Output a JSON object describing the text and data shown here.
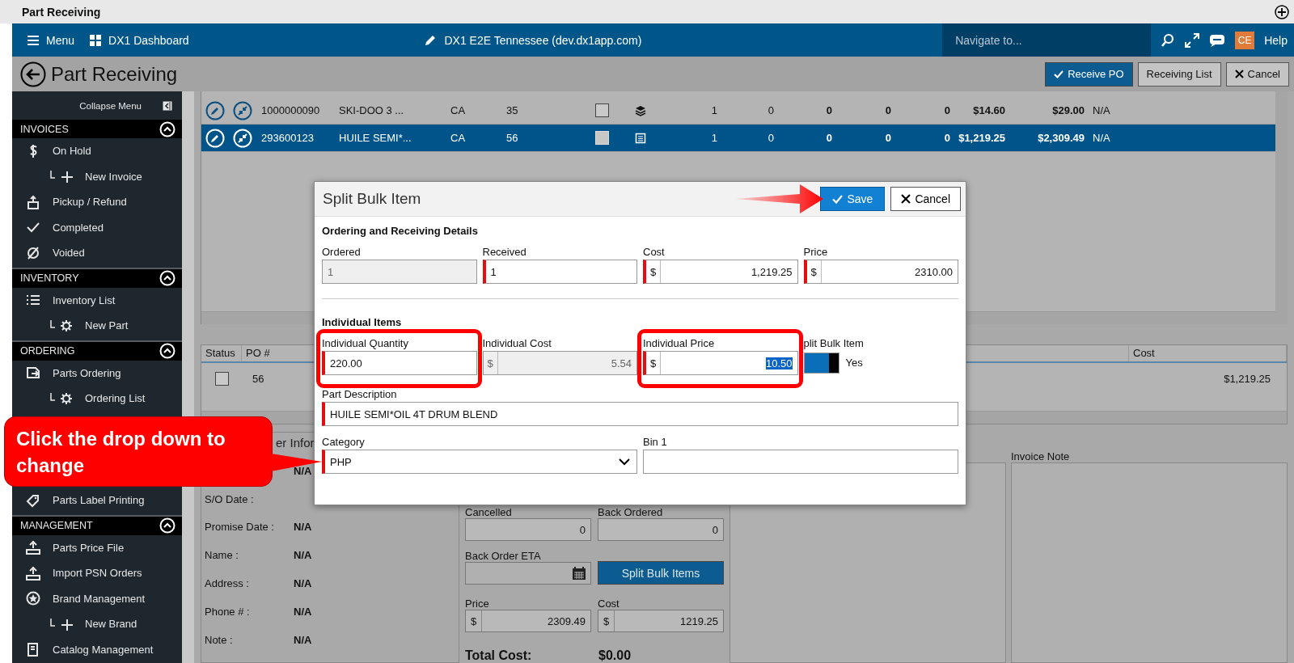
{
  "app_title": "Part Receiving",
  "nav": {
    "menu": "Menu",
    "dashboard": "DX1 Dashboard",
    "site": "DX1 E2E Tennessee (dev.dx1app.com)",
    "search_placeholder": "Navigate to...",
    "user_initials": "CE",
    "help": "Help"
  },
  "page": {
    "title": "Part Receiving",
    "buttons": [
      {
        "label": "Receive PO",
        "kind": "primary"
      },
      {
        "label": "Receiving List",
        "kind": "plain"
      },
      {
        "label": "Cancel",
        "kind": "cancel"
      }
    ]
  },
  "sidebar": {
    "collapse": "Collapse Menu",
    "sections": [
      {
        "title": "INVOICES",
        "expanded": true,
        "items": [
          {
            "label": "On Hold",
            "kind": "dollar",
            "children": [
              {
                "label": "New Invoice",
                "kind": "plus"
              }
            ]
          },
          {
            "label": "Pickup / Refund",
            "kind": "box"
          },
          {
            "label": "Completed",
            "kind": "check"
          },
          {
            "label": "Voided",
            "kind": "void"
          }
        ]
      },
      {
        "title": "INVENTORY",
        "expanded": true,
        "items": [
          {
            "label": "Inventory List",
            "kind": "list",
            "children": [
              {
                "label": "New Part",
                "kind": "gear"
              }
            ]
          }
        ]
      },
      {
        "title": "ORDERING",
        "expanded": true,
        "items": [
          {
            "label": "Parts Ordering",
            "kind": "order",
            "children": [
              {
                "label": "Ordering List",
                "kind": "gear"
              }
            ]
          },
          {
            "label": "Parts Label Printing",
            "kind": "tag"
          }
        ]
      },
      {
        "title": "MANAGEMENT",
        "expanded": true,
        "items": [
          {
            "label": "Parts Price File",
            "kind": "upload"
          },
          {
            "label": "Import PSN Orders",
            "kind": "upload"
          },
          {
            "label": "Brand Management",
            "kind": "star",
            "children": [
              {
                "label": "New Brand",
                "kind": "plus"
              }
            ]
          },
          {
            "label": "Catalog Management",
            "kind": "book"
          }
        ]
      }
    ]
  },
  "parts_table": {
    "rows": [
      {
        "selected": false,
        "cells": [
          "1000000090",
          "SKI-DOO 3 ...",
          "CA",
          "35"
        ],
        "checked": false,
        "kind": "stack",
        "counts": [
          "1",
          "0",
          "0",
          "0",
          "0"
        ],
        "cost": "$14.60",
        "price": "$29.00",
        "status": "N/A"
      },
      {
        "selected": true,
        "cells": [
          "293600123",
          "HUILE SEMI*...",
          "CA",
          "56"
        ],
        "checked": false,
        "kind": "document",
        "counts": [
          "1",
          "0",
          "0",
          "0",
          "0"
        ],
        "cost": "$1,219.25",
        "price": "$2,309.49",
        "status": "N/A"
      }
    ]
  },
  "po_table": {
    "columns": [
      "Status",
      "PO #",
      "Cost"
    ],
    "rows": [
      {
        "checked": false,
        "po": "56",
        "cost": "$1,219.25"
      }
    ]
  },
  "order_info": {
    "title": "er Infor",
    "fields": [
      {
        "value": "N/A"
      },
      {
        "label": "S/O Date :"
      },
      {
        "label": "Promise Date :",
        "value": "N/A"
      },
      {
        "label": "Name :",
        "value": "N/A"
      },
      {
        "label": "Address :",
        "value": "N/A"
      },
      {
        "label": "Phone # :",
        "value": "N/A"
      },
      {
        "label": "Note :",
        "value": "N/A"
      }
    ]
  },
  "receiving": {
    "pairs": [
      [
        {
          "label": "Cancelled",
          "value": "0"
        },
        {
          "label": "Back Ordered",
          "value": "0"
        }
      ]
    ],
    "eta": {
      "label": "Back Order ETA"
    },
    "split_button": "Split Bulk Items",
    "prices": [
      {
        "label": "Price",
        "prefix": "$",
        "value": "2309.49"
      },
      {
        "label": "Cost",
        "prefix": "$",
        "value": "1219.25"
      }
    ],
    "total_label": "Total Cost:",
    "total": "$0.00"
  },
  "invoice_note": {
    "label": "Invoice Note"
  },
  "modal": {
    "title": "Split Bulk Item",
    "save": "Save",
    "cancel": "Cancel",
    "section1": "Ordering and Receiving Details",
    "fields1": [
      {
        "label": "Ordered",
        "value": "1",
        "disabled": true,
        "required": false
      },
      {
        "label": "Received",
        "value": "1",
        "required": true
      },
      {
        "label": "Cost",
        "prefix": "$",
        "value": "1,219.25",
        "required": true
      },
      {
        "label": "Price",
        "prefix": "$",
        "value": "2310.00",
        "required": true
      }
    ],
    "section2": "Individual Items",
    "fields2": [
      {
        "label": "Individual Quantity",
        "value": "220.00",
        "required": true,
        "highlighted": true
      },
      {
        "label": "Individual Cost",
        "prefix": "$",
        "value": "5.54",
        "disabled": true,
        "required": false
      },
      {
        "label": "Individual Price",
        "prefix": "$",
        "value": "10.50",
        "required": true,
        "highlighted": true,
        "text_selected": true
      }
    ],
    "toggle": {
      "label": "plit Bulk Item",
      "on": true,
      "text": "Yes"
    },
    "description": {
      "label": "Part Description",
      "value": "HUILE SEMI*OIL 4T DRUM BLEND",
      "required": true
    },
    "category": {
      "label": "Category",
      "value": "PHP",
      "required": true
    },
    "bin": {
      "label": "Bin 1"
    }
  },
  "callout": {
    "text": "Click the drop down to change"
  }
}
